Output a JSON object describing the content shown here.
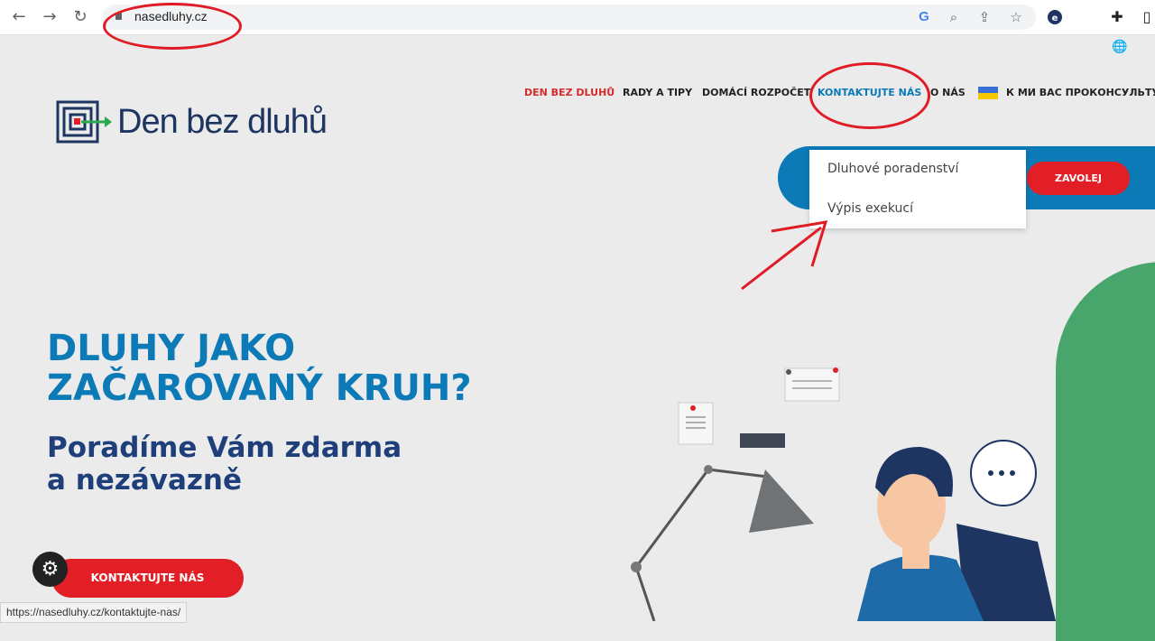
{
  "browser": {
    "url": "nasedluhy.cz",
    "status_url": "https://nasedluhy.cz/kontaktujte-nas/"
  },
  "site": {
    "logo_text": "Den bez dluhů",
    "nav": [
      {
        "label": "DEN BEZ DLUHŮ"
      },
      {
        "label": "RADY A TIPY"
      },
      {
        "label": "DOMÁCÍ ROZPOČET"
      },
      {
        "label": "KONTAKTUJTE NÁS"
      },
      {
        "label": "O NÁS"
      },
      {
        "label": "К МИ ВАС ПРОКОНСУЛЬТУЄМ"
      }
    ],
    "dropdown": [
      {
        "label": "Dluhové poradenství"
      },
      {
        "label": "Výpis exekucí"
      }
    ],
    "call_button": "ZAVOLEJ",
    "hero_title_line1": "DLUHY JAKO",
    "hero_title_line2": "ZAČAROVANÝ KRUH?",
    "hero_sub_line1": "Poradíme Vám zdarma",
    "hero_sub_line2": "a nezávazně",
    "contact_button": "KONTAKTUJTE NÁS"
  },
  "colors": {
    "brand_blue": "#0b7ab7",
    "brand_red": "#e21f26",
    "navy": "#1e3561",
    "green": "#48a56b",
    "annotation": "#e01b24"
  }
}
